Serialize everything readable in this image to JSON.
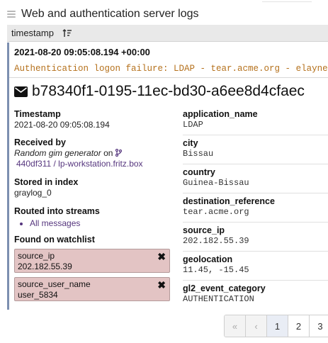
{
  "widget": {
    "title": "Web and authentication server logs"
  },
  "table": {
    "column_header": "timestamp"
  },
  "message": {
    "timestamp_header": "2021-08-20 09:05:08.194 +00:00",
    "text": "Authentication logon failure: LDAP - tear.acme.org - elayne",
    "id": "b78340f1-0195-11ec-bd30-a6ee8d4cfaec"
  },
  "left": {
    "timestamp_label": "Timestamp",
    "timestamp_value": "2021-08-20 09:05:08.194",
    "received_label": "Received by",
    "received_input": "Random gim generator",
    "received_on": "on",
    "received_node": "440df311 / lp-workstation.fritz.box",
    "index_label": "Stored in index",
    "index_value": "graylog_0",
    "streams_label": "Routed into streams",
    "streams": [
      "All messages"
    ],
    "watchlist_label": "Found on watchlist",
    "watchlist": [
      {
        "field": "source_ip",
        "value": "202.182.55.39"
      },
      {
        "field": "source_user_name",
        "value": "user_5834"
      }
    ]
  },
  "fields": [
    {
      "name": "application_name",
      "value": "LDAP"
    },
    {
      "name": "city",
      "value": "Bissau"
    },
    {
      "name": "country",
      "value": "Guinea-Bissau"
    },
    {
      "name": "destination_reference",
      "value": "tear.acme.org"
    },
    {
      "name": "source_ip",
      "value": "202.182.55.39"
    },
    {
      "name": "geolocation",
      "value": "11.45, -15.45"
    },
    {
      "name": "gl2_event_category",
      "value": "AUTHENTICATION"
    }
  ],
  "pagination": {
    "first": "«",
    "prev": "‹",
    "pages": [
      "1",
      "2",
      "3"
    ],
    "current": "1"
  },
  "icons": {
    "menu": "hamburger-icon",
    "sort": "sort-descending-icon",
    "message": "envelope-icon",
    "node": "branch-icon",
    "remove": "close-icon"
  },
  "colors": {
    "message_text": "#b5711c",
    "link": "#56367e",
    "watchlist_bg": "#e3c4c4",
    "message_border": "#7c8fb0"
  }
}
